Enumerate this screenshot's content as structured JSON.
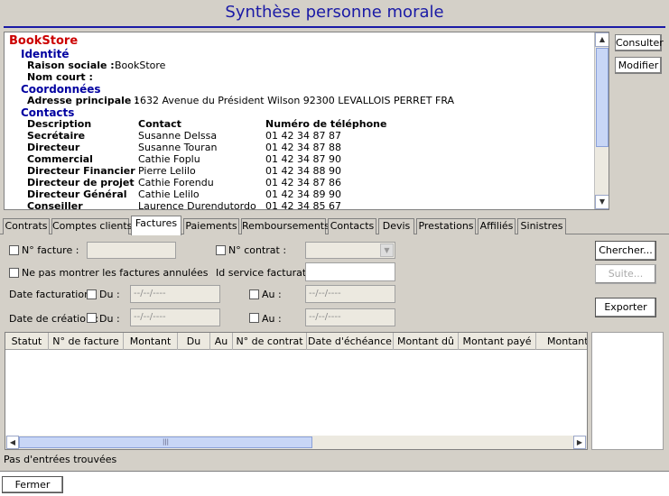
{
  "window": {
    "title": "Synthèse personne morale"
  },
  "summary": {
    "company": "BookStore",
    "sections": {
      "identity": "Identité",
      "coordinates": "Coordonnées",
      "contacts": "Contacts"
    },
    "raison_sociale_label": "Raison sociale :",
    "raison_sociale_value": "BookStore",
    "nom_court_label": "Nom court :",
    "adresse_label": "Adresse principale :",
    "adresse_value": "1632 Avenue du Président Wilson  92300 LEVALLOIS PERRET FRA",
    "contacts_header": {
      "description": "Description",
      "contact": "Contact",
      "phone": "Numéro de téléphone"
    },
    "contacts": [
      {
        "description": "Secrétaire",
        "contact": "Susanne Delssa",
        "phone": "01 42 34 87 87"
      },
      {
        "description": "Directeur",
        "contact": "Susanne Touran",
        "phone": "01 42 34 87 88"
      },
      {
        "description": "Commercial",
        "contact": "Cathie Foplu",
        "phone": "01 42 34 87 90"
      },
      {
        "description": "Directeur Financier",
        "contact": "Pierre Lelilo",
        "phone": "01 42 34 88 90"
      },
      {
        "description": "Directeur de projet",
        "contact": "Cathie Forendu",
        "phone": "01 42 34 87 86"
      },
      {
        "description": "Directeur Général",
        "contact": "Cathie Lelilo",
        "phone": "01 42 34 89 90"
      },
      {
        "description": "Conseiller",
        "contact": "Laurence Durendutordo",
        "phone": "01 42 34 85 67"
      }
    ]
  },
  "side_buttons": {
    "consulter": "Consulter",
    "modifier": "Modifier"
  },
  "tabs": [
    {
      "label": "Contrats",
      "active": false
    },
    {
      "label": "Comptes clients",
      "active": false
    },
    {
      "label": "Factures",
      "active": true
    },
    {
      "label": "Paiements",
      "active": false
    },
    {
      "label": "Remboursements",
      "active": false
    },
    {
      "label": "Contacts",
      "active": false
    },
    {
      "label": "Devis",
      "active": false
    },
    {
      "label": "Prestations",
      "active": false
    },
    {
      "label": "Affiliés",
      "active": false
    },
    {
      "label": "Sinistres",
      "active": false
    }
  ],
  "filters": {
    "invoice_no_label": "N° facture :",
    "contract_no_label": "N° contrat :",
    "hide_cancelled_label": "Ne pas montrer les factures annulées",
    "service_id_label": "Id service facturat° :",
    "billing_date_label": "Date facturation :",
    "creation_date_label": "Date de création :",
    "du_label": "Du :",
    "au_label": "Au :",
    "date_placeholder": "--/--/----"
  },
  "actions": {
    "search": "Chercher...",
    "next": "Suite...",
    "export": "Exporter"
  },
  "grid": {
    "columns": [
      "Statut",
      "N° de facture",
      "Montant",
      "Du",
      "Au",
      "N° de contrat",
      "Date d'échéance",
      "Montant dû",
      "Montant payé",
      "Montant p"
    ]
  },
  "status_text": "Pas d'entrées trouvées",
  "footer": {
    "close": "Fermer"
  }
}
